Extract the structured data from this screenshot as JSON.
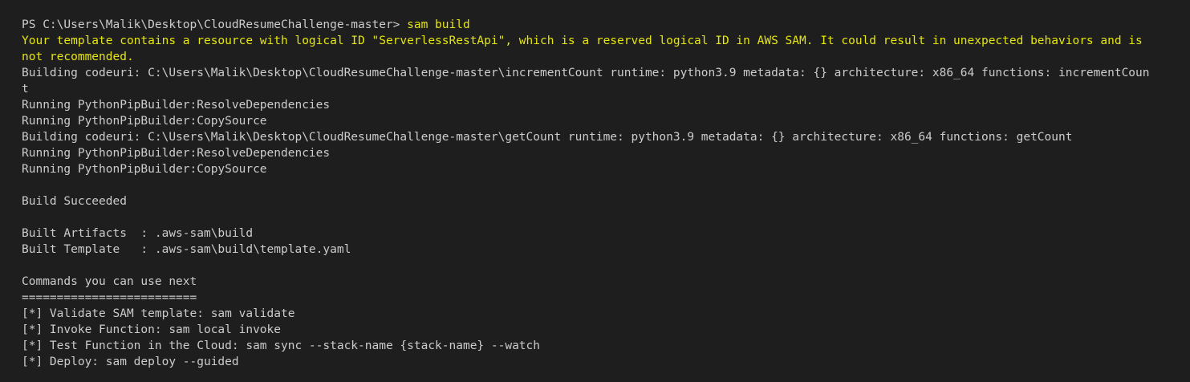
{
  "terminal": {
    "prompt": "PS C:\\Users\\Malik\\Desktop\\CloudResumeChallenge-master> ",
    "command": "sam build",
    "warning_line1": "Your template contains a resource with logical ID \"ServerlessRestApi\", which is a reserved logical ID in AWS SAM. It could result in unexpected behaviors and is",
    "warning_line2": "not recommended.",
    "build1_line1": "Building codeuri: C:\\Users\\Malik\\Desktop\\CloudResumeChallenge-master\\incrementCount runtime: python3.9 metadata: {} architecture: x86_64 functions: incrementCoun",
    "build1_line2": "t",
    "resolve1": "Running PythonPipBuilder:ResolveDependencies",
    "copy1": "Running PythonPipBuilder:CopySource",
    "build2": "Building codeuri: C:\\Users\\Malik\\Desktop\\CloudResumeChallenge-master\\getCount runtime: python3.9 metadata: {} architecture: x86_64 functions: getCount",
    "resolve2": "Running PythonPipBuilder:ResolveDependencies",
    "copy2": "Running PythonPipBuilder:CopySource",
    "succeeded": "Build Succeeded",
    "artifacts": "Built Artifacts  : .aws-sam\\build",
    "template": "Built Template   : .aws-sam\\build\\template.yaml",
    "next_header": "Commands you can use next",
    "separator": "=========================",
    "next_validate": "[*] Validate SAM template: sam validate",
    "next_invoke": "[*] Invoke Function: sam local invoke",
    "next_test": "[*] Test Function in the Cloud: sam sync --stack-name {stack-name} --watch",
    "next_deploy": "[*] Deploy: sam deploy --guided"
  },
  "colors": {
    "background": "#1e1e1e",
    "text": "#cccccc",
    "warning": "#e5e510"
  }
}
